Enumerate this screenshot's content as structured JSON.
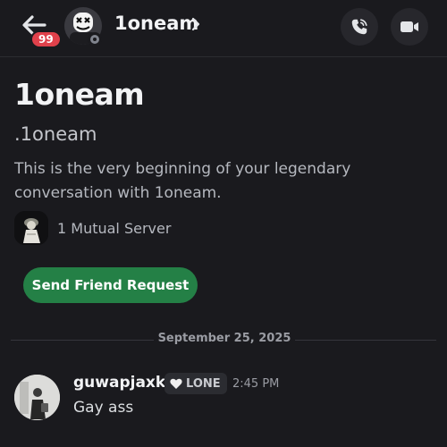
{
  "header": {
    "unread_count": "99",
    "title": "1oneam",
    "icons": {
      "back": "arrow-left-icon",
      "chevron": "chevron-right-icon",
      "call": "phone-call-icon",
      "video": "video-camera-icon"
    },
    "status": "offline"
  },
  "profile": {
    "display_name": "1oneam",
    "username": ".1oneam",
    "intro": "This is the very beginning of your legendary conversation with 1oneam.",
    "mutual_servers": "1 Mutual Server",
    "friend_button_label": "Send Friend Request"
  },
  "messages": {
    "date_divider": "September 25, 2025",
    "items": [
      {
        "author": "guwapjaxk",
        "clan_tag": "LONE",
        "clan_icon": "heart-icon",
        "time": "2:45 PM",
        "content": "Gay ass"
      }
    ]
  },
  "colors": {
    "background": "#1a1a1e",
    "accent_green": "#248046",
    "badge_red": "#e0414b",
    "muted_text": "#b5b8bf"
  }
}
